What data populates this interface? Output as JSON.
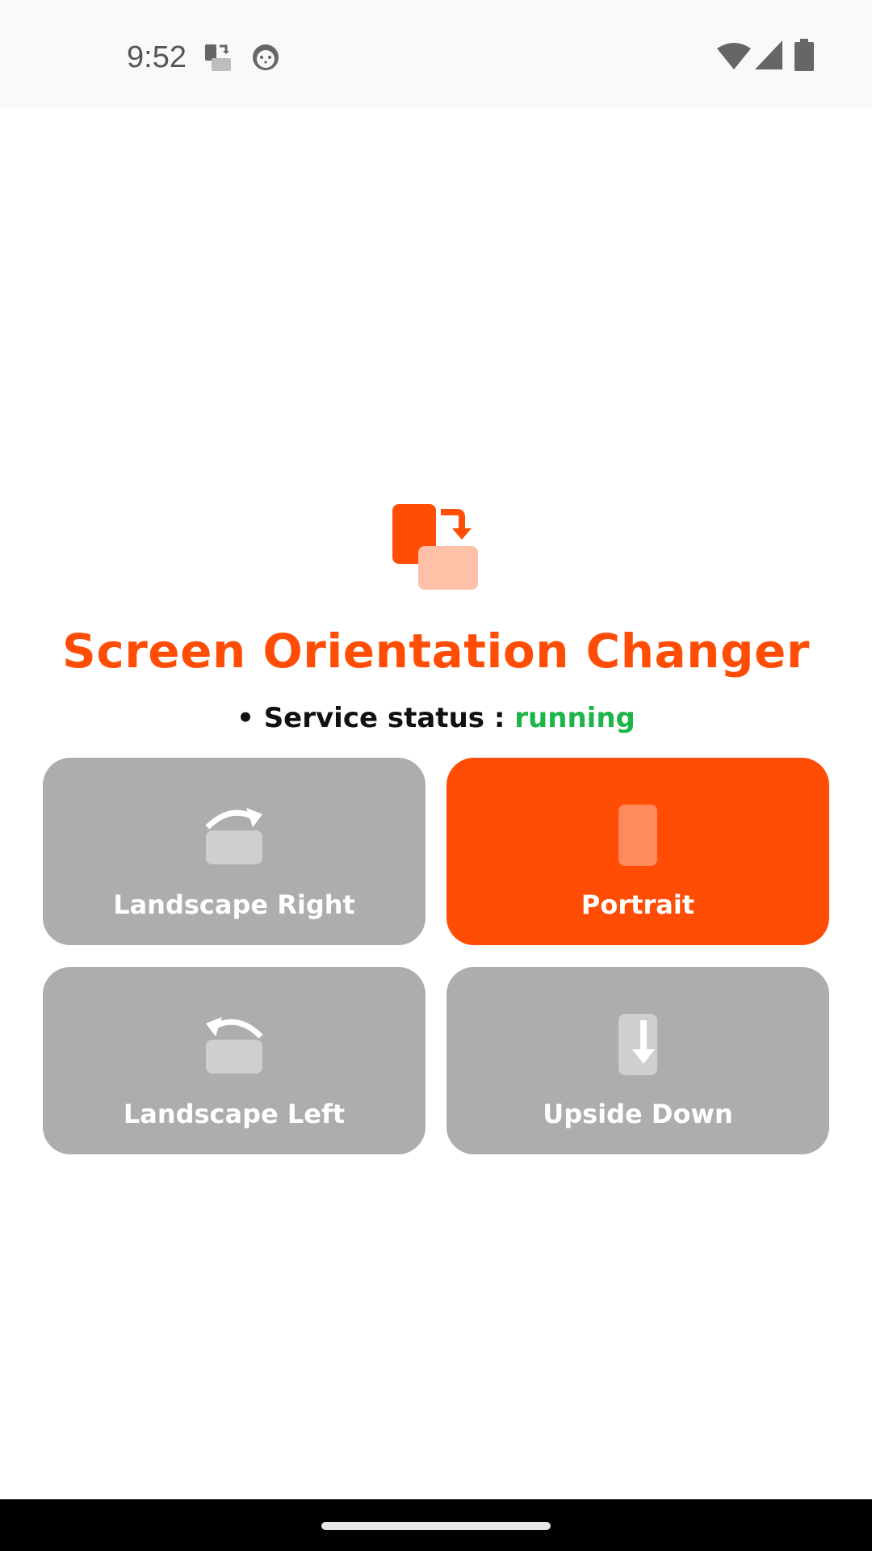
{
  "status_bar": {
    "time": "9:52",
    "icons": [
      "screen-rotation-app-icon",
      "cat-face-icon",
      "wifi-icon",
      "cell-signal-icon",
      "battery-icon"
    ]
  },
  "app": {
    "title": "Screen Orientation Changer",
    "status_prefix": "• Service status : ",
    "status_value": "running"
  },
  "buttons": [
    {
      "label": "Landscape Right",
      "icon": "rotate-right-icon",
      "active": false
    },
    {
      "label": "Portrait",
      "icon": "portrait-icon",
      "active": true
    },
    {
      "label": "Landscape Left",
      "icon": "rotate-left-icon",
      "active": false
    },
    {
      "label": "Upside Down",
      "icon": "upside-down-icon",
      "active": false
    }
  ],
  "colors": {
    "accent": "#ff4d05",
    "accent_light": "#ffc0a8",
    "inactive_button": "#adadad",
    "running_green": "#1cb548"
  }
}
